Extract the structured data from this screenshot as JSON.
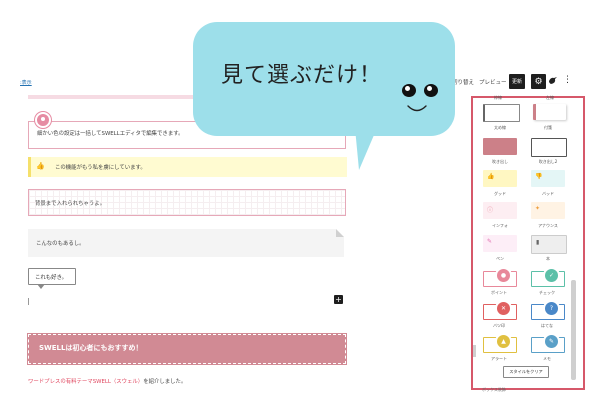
{
  "toolbar": {
    "view_link": ":表示",
    "replace_label": "切り替え",
    "preview_label": "プレビュー",
    "publish_label": "更新",
    "gear_icon": "gear-icon",
    "bird_icon": "bird-icon",
    "more_icon": "more-icon"
  },
  "bubble": {
    "text": "見て選ぶだけ！",
    "bg_color": "#9ddfea"
  },
  "editor": {
    "blocks": [
      {
        "type": "pin-box",
        "text": "細かい色の設定は一括してSWELLエディタで編集できます。"
      },
      {
        "type": "good-box",
        "text": "この機能がもう私を虜にしています。"
      },
      {
        "type": "grid-box",
        "text": "背景まで入れられちゃうよ。"
      },
      {
        "type": "fold-box",
        "text": "こんなのもあるし。"
      },
      {
        "type": "speech-box",
        "text": "これも好き。"
      },
      {
        "type": "heading",
        "text": "SWELLは初心者にもおすすめ！"
      }
    ],
    "paragraph_link": "ワードプレスの有料テーマSWELL（スウェル）",
    "paragraph_rest": "を紹介しました。",
    "accent": "#d18a94"
  },
  "style_panel": {
    "border_color": "#d6586a",
    "top_labels": [
      "枠線",
      "左線"
    ],
    "items": [
      {
        "label": "太め線",
        "color": "#ffffff",
        "border": "#888888"
      },
      {
        "label": "付箋",
        "color": "#ffffff",
        "border": "#cccccc"
      },
      {
        "label": "吹き出し",
        "color": "#cc8088",
        "border": "#cc8088"
      },
      {
        "label": "吹き出し2",
        "color": "#ffffff",
        "border": "#555555"
      },
      {
        "label": "グッド",
        "color": "#fff7c2",
        "border": "#fff7c2"
      },
      {
        "label": "バッド",
        "color": "#e4f6f6",
        "border": "#e4f6f6"
      },
      {
        "label": "インフォ",
        "color": "#fdeef2",
        "border": "#fdeef2"
      },
      {
        "label": "アナウンス",
        "color": "#fff3e4",
        "border": "#fff3e4"
      },
      {
        "label": "ペン",
        "color": "#fdeef7",
        "border": "#fdeef7"
      },
      {
        "label": "本",
        "color": "#eeeeee",
        "border": "#cccccc"
      },
      {
        "label": "ポイント",
        "color": "#ffffff",
        "border": "#e8889a"
      },
      {
        "label": "チェック",
        "color": "#ffffff",
        "border": "#5cc0a8"
      },
      {
        "label": "バツ印",
        "color": "#ffffff",
        "border": "#e06060"
      },
      {
        "label": "はてな",
        "color": "#ffffff",
        "border": "#4a88c8"
      },
      {
        "label": "アラート",
        "color": "#ffffff",
        "border": "#e0c040"
      },
      {
        "label": "メモ",
        "color": "#ffffff",
        "border": "#5aa0c8"
      }
    ],
    "clear_button": "スタイルをクリア",
    "bottom_text": "ボックス装飾"
  }
}
